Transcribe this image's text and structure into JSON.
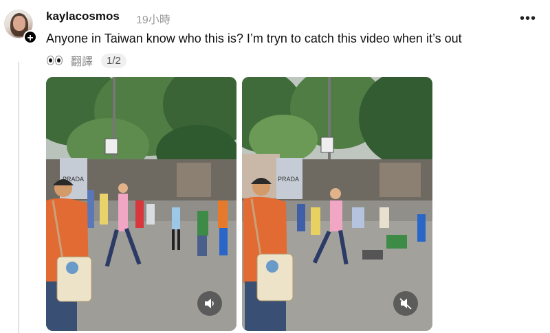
{
  "post": {
    "username": "kaylacosmos",
    "timestamp": "19小時",
    "more": "•••",
    "text": "Anyone in Taiwan know who this is? I’m tryn to catch this video when it’s out",
    "translate_label": "翻譯",
    "page_indicator": "1/2"
  },
  "media": [
    {
      "audio_state": "unmuted",
      "audio_icon": "speaker-icon"
    },
    {
      "audio_state": "muted",
      "audio_icon": "speaker-muted-icon"
    }
  ],
  "icons": {
    "follow": "plus-icon",
    "reaction": "eyes-emoji-icon"
  },
  "colors": {
    "text": "#111111",
    "secondary": "#999999",
    "thread_line": "#e2e2e2",
    "audio_button": "#505050"
  }
}
